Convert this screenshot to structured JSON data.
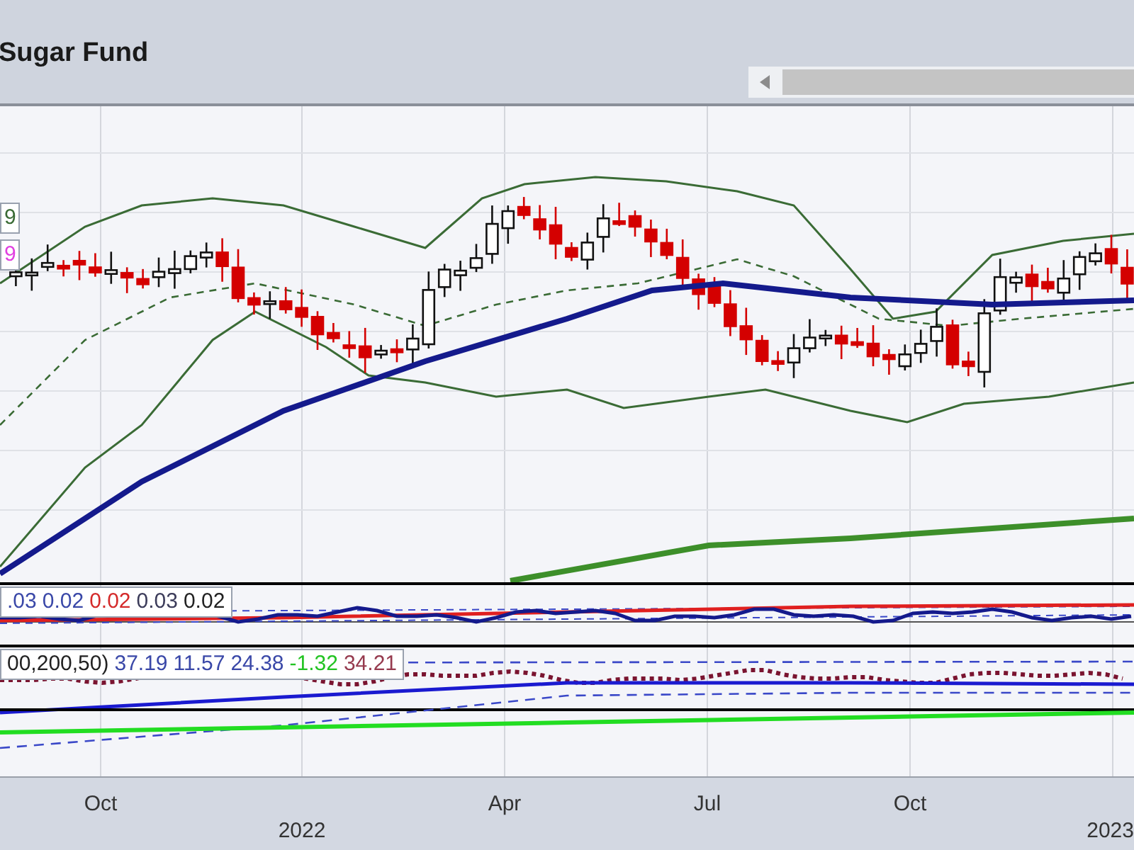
{
  "header": {
    "title": "Sugar Fund"
  },
  "price_panel": {
    "legend": [
      {
        "text": "9",
        "color": "#3a6b35"
      },
      {
        "text": "9",
        "color": "#e040e0"
      }
    ]
  },
  "indicator_panel_1": {
    "legend": [
      {
        "text": ".03",
        "color": "#3a48a8"
      },
      {
        "text": "0.02",
        "color": "#3a48a8"
      },
      {
        "text": "0.02",
        "color": "#d42a2a"
      },
      {
        "text": "0.03",
        "color": "#3c3c5a"
      },
      {
        "text": "0.02",
        "color": "#222222"
      }
    ]
  },
  "indicator_panel_2": {
    "legend": [
      {
        "text": "00,200,50)",
        "color": "#222222"
      },
      {
        "text": "37.19",
        "color": "#3a48a8"
      },
      {
        "text": "11.57",
        "color": "#3a48a8"
      },
      {
        "text": "24.38",
        "color": "#3a48a8"
      },
      {
        "text": "-1.32",
        "color": "#22c322"
      },
      {
        "text": "34.21",
        "color": "#963a4e"
      }
    ]
  },
  "x_axis": {
    "months": [
      {
        "text": "Oct"
      },
      {
        "text": "Apr"
      },
      {
        "text": "Jul"
      },
      {
        "text": "Oct"
      }
    ],
    "years": [
      {
        "text": "2022"
      },
      {
        "text": "2023"
      }
    ]
  }
}
